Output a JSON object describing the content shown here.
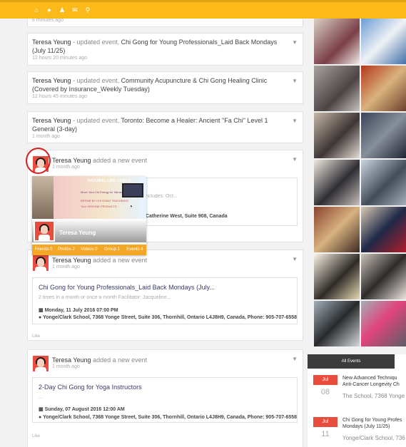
{
  "nav": {
    "icons": [
      "home-icon",
      "globe-icon",
      "people-icon",
      "mail-icon",
      "search-icon"
    ]
  },
  "feed": {
    "top_time": "8 minutes ago",
    "items": [
      {
        "who": "Teresa Yeung",
        "action": " - updated event, ",
        "event": "Chi Gong for Young Professionals_Laid Back Mondays (July 11/25)",
        "time": "12 hours 20 minutes ago"
      },
      {
        "who": "Teresa Yeung",
        "action": " - updated event, ",
        "event": "Community Acupuncture & Chi Gong Healing Clinic (Covered by Insurance_Weekly Tuesday)",
        "time": "12 hours 45 minutes ago"
      },
      {
        "who": "Teresa Yeung",
        "action": " - updated event, ",
        "event": "Toronto: Become a Healer: Ancient \"Fa Chi\" Level 1 General (3-day)",
        "time": "1 month ago"
      }
    ],
    "new_event_1": {
      "who": "Teresa Yeung",
      "action": " added a new event",
      "time": "1 month ago",
      "partial_desc": "ncludes: Oct...",
      "partial_addr": "Catherine West, Suite 908, Canada"
    },
    "new_event_2": {
      "who": "Teresa Yeung",
      "action": " added a new event",
      "time": "1 month ago",
      "title": "Chi Gong for Young Professionals_Laid Back Mondays (July...",
      "desc": "2 times in a month or once a month Facilitator: Jacqueline...",
      "date": "Monday, 11 July 2016 07:00 PM",
      "addr": "Yonge/Clark School, 7368 Yonge Street, Suite 306, Thornhill, Ontario L4J8H9, Canada, Phone: 905-707-6558",
      "like": "Like"
    },
    "new_event_3": {
      "who": "Teresa Yeung",
      "action": " added a new event",
      "time": "1 month ago",
      "title": "2-Day Chi Gong for Yoga Instructors",
      "desc": "...",
      "date": "Sunday, 07 August 2016 12:00 AM",
      "addr": "Yonge/Clark School, 7368 Yonge Street, Suite 306, Thornhill, Ontario L4J8H9, Canada, Phone: 905-707-6558",
      "like": "Like"
    }
  },
  "popcard": {
    "name": "Teresa Yeung",
    "banner": {
      "brand": "NATURAL LIFE FORCE",
      "tag1": "Move Your Chi Energy for Vibrant Health",
      "tag2": "REFINE BY CHI GONG TEACHINGS",
      "tag3": "Your ORGONE PRODUCTS"
    },
    "tabs": [
      "Friends 0",
      "Photos 2",
      "Videos 0",
      "Group 1",
      "Events 4"
    ]
  },
  "right_panel": {
    "tab": "All Events",
    "events": [
      {
        "month": "Jul",
        "day": "08",
        "title": "New Advanced Techniqu\nAnti-Cancer Longevity Ch",
        "loc": "The School, 7368 Yonge"
      },
      {
        "month": "Jul",
        "day": "11",
        "title": "Chi Gong for Young Profes\nMondays (July 11/25)",
        "loc": "Yonge/Clark School, 736"
      }
    ]
  },
  "colors": {
    "topbar": "#fbb91a",
    "accent_red": "#e84c3d",
    "tab_orange": "#f4a724"
  }
}
